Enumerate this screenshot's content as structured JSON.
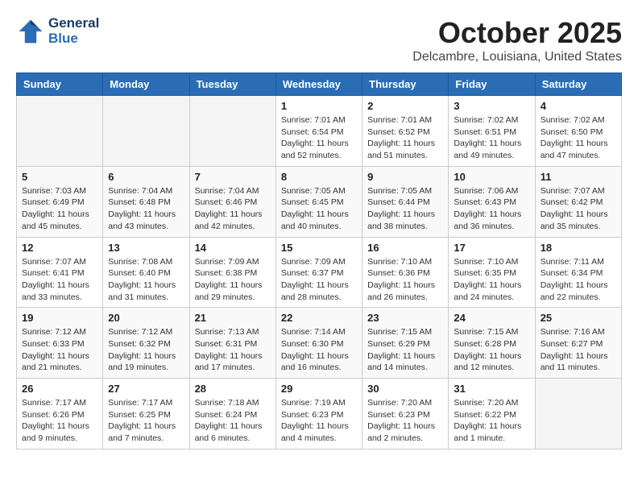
{
  "header": {
    "logo_general": "General",
    "logo_blue": "Blue",
    "month": "October 2025",
    "location": "Delcambre, Louisiana, United States"
  },
  "days_of_week": [
    "Sunday",
    "Monday",
    "Tuesday",
    "Wednesday",
    "Thursday",
    "Friday",
    "Saturday"
  ],
  "weeks": [
    [
      {
        "day": "",
        "sunrise": "",
        "sunset": "",
        "daylight": ""
      },
      {
        "day": "",
        "sunrise": "",
        "sunset": "",
        "daylight": ""
      },
      {
        "day": "",
        "sunrise": "",
        "sunset": "",
        "daylight": ""
      },
      {
        "day": "1",
        "sunrise": "Sunrise: 7:01 AM",
        "sunset": "Sunset: 6:54 PM",
        "daylight": "Daylight: 11 hours and 52 minutes."
      },
      {
        "day": "2",
        "sunrise": "Sunrise: 7:01 AM",
        "sunset": "Sunset: 6:52 PM",
        "daylight": "Daylight: 11 hours and 51 minutes."
      },
      {
        "day": "3",
        "sunrise": "Sunrise: 7:02 AM",
        "sunset": "Sunset: 6:51 PM",
        "daylight": "Daylight: 11 hours and 49 minutes."
      },
      {
        "day": "4",
        "sunrise": "Sunrise: 7:02 AM",
        "sunset": "Sunset: 6:50 PM",
        "daylight": "Daylight: 11 hours and 47 minutes."
      }
    ],
    [
      {
        "day": "5",
        "sunrise": "Sunrise: 7:03 AM",
        "sunset": "Sunset: 6:49 PM",
        "daylight": "Daylight: 11 hours and 45 minutes."
      },
      {
        "day": "6",
        "sunrise": "Sunrise: 7:04 AM",
        "sunset": "Sunset: 6:48 PM",
        "daylight": "Daylight: 11 hours and 43 minutes."
      },
      {
        "day": "7",
        "sunrise": "Sunrise: 7:04 AM",
        "sunset": "Sunset: 6:46 PM",
        "daylight": "Daylight: 11 hours and 42 minutes."
      },
      {
        "day": "8",
        "sunrise": "Sunrise: 7:05 AM",
        "sunset": "Sunset: 6:45 PM",
        "daylight": "Daylight: 11 hours and 40 minutes."
      },
      {
        "day": "9",
        "sunrise": "Sunrise: 7:05 AM",
        "sunset": "Sunset: 6:44 PM",
        "daylight": "Daylight: 11 hours and 38 minutes."
      },
      {
        "day": "10",
        "sunrise": "Sunrise: 7:06 AM",
        "sunset": "Sunset: 6:43 PM",
        "daylight": "Daylight: 11 hours and 36 minutes."
      },
      {
        "day": "11",
        "sunrise": "Sunrise: 7:07 AM",
        "sunset": "Sunset: 6:42 PM",
        "daylight": "Daylight: 11 hours and 35 minutes."
      }
    ],
    [
      {
        "day": "12",
        "sunrise": "Sunrise: 7:07 AM",
        "sunset": "Sunset: 6:41 PM",
        "daylight": "Daylight: 11 hours and 33 minutes."
      },
      {
        "day": "13",
        "sunrise": "Sunrise: 7:08 AM",
        "sunset": "Sunset: 6:40 PM",
        "daylight": "Daylight: 11 hours and 31 minutes."
      },
      {
        "day": "14",
        "sunrise": "Sunrise: 7:09 AM",
        "sunset": "Sunset: 6:38 PM",
        "daylight": "Daylight: 11 hours and 29 minutes."
      },
      {
        "day": "15",
        "sunrise": "Sunrise: 7:09 AM",
        "sunset": "Sunset: 6:37 PM",
        "daylight": "Daylight: 11 hours and 28 minutes."
      },
      {
        "day": "16",
        "sunrise": "Sunrise: 7:10 AM",
        "sunset": "Sunset: 6:36 PM",
        "daylight": "Daylight: 11 hours and 26 minutes."
      },
      {
        "day": "17",
        "sunrise": "Sunrise: 7:10 AM",
        "sunset": "Sunset: 6:35 PM",
        "daylight": "Daylight: 11 hours and 24 minutes."
      },
      {
        "day": "18",
        "sunrise": "Sunrise: 7:11 AM",
        "sunset": "Sunset: 6:34 PM",
        "daylight": "Daylight: 11 hours and 22 minutes."
      }
    ],
    [
      {
        "day": "19",
        "sunrise": "Sunrise: 7:12 AM",
        "sunset": "Sunset: 6:33 PM",
        "daylight": "Daylight: 11 hours and 21 minutes."
      },
      {
        "day": "20",
        "sunrise": "Sunrise: 7:12 AM",
        "sunset": "Sunset: 6:32 PM",
        "daylight": "Daylight: 11 hours and 19 minutes."
      },
      {
        "day": "21",
        "sunrise": "Sunrise: 7:13 AM",
        "sunset": "Sunset: 6:31 PM",
        "daylight": "Daylight: 11 hours and 17 minutes."
      },
      {
        "day": "22",
        "sunrise": "Sunrise: 7:14 AM",
        "sunset": "Sunset: 6:30 PM",
        "daylight": "Daylight: 11 hours and 16 minutes."
      },
      {
        "day": "23",
        "sunrise": "Sunrise: 7:15 AM",
        "sunset": "Sunset: 6:29 PM",
        "daylight": "Daylight: 11 hours and 14 minutes."
      },
      {
        "day": "24",
        "sunrise": "Sunrise: 7:15 AM",
        "sunset": "Sunset: 6:28 PM",
        "daylight": "Daylight: 11 hours and 12 minutes."
      },
      {
        "day": "25",
        "sunrise": "Sunrise: 7:16 AM",
        "sunset": "Sunset: 6:27 PM",
        "daylight": "Daylight: 11 hours and 11 minutes."
      }
    ],
    [
      {
        "day": "26",
        "sunrise": "Sunrise: 7:17 AM",
        "sunset": "Sunset: 6:26 PM",
        "daylight": "Daylight: 11 hours and 9 minutes."
      },
      {
        "day": "27",
        "sunrise": "Sunrise: 7:17 AM",
        "sunset": "Sunset: 6:25 PM",
        "daylight": "Daylight: 11 hours and 7 minutes."
      },
      {
        "day": "28",
        "sunrise": "Sunrise: 7:18 AM",
        "sunset": "Sunset: 6:24 PM",
        "daylight": "Daylight: 11 hours and 6 minutes."
      },
      {
        "day": "29",
        "sunrise": "Sunrise: 7:19 AM",
        "sunset": "Sunset: 6:23 PM",
        "daylight": "Daylight: 11 hours and 4 minutes."
      },
      {
        "day": "30",
        "sunrise": "Sunrise: 7:20 AM",
        "sunset": "Sunset: 6:23 PM",
        "daylight": "Daylight: 11 hours and 2 minutes."
      },
      {
        "day": "31",
        "sunrise": "Sunrise: 7:20 AM",
        "sunset": "Sunset: 6:22 PM",
        "daylight": "Daylight: 11 hours and 1 minute."
      },
      {
        "day": "",
        "sunrise": "",
        "sunset": "",
        "daylight": ""
      }
    ]
  ]
}
